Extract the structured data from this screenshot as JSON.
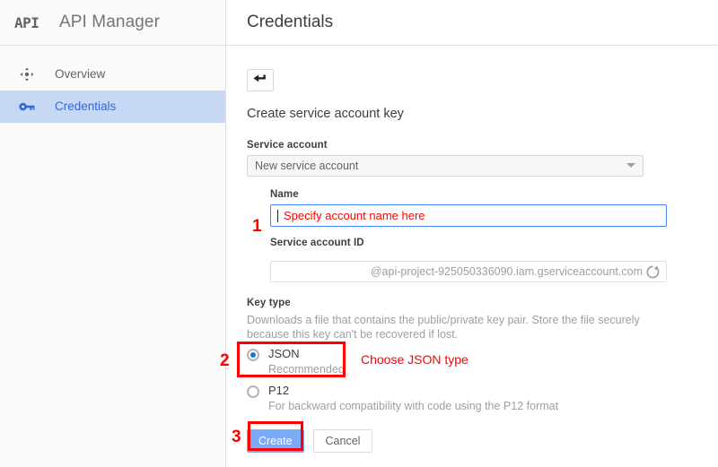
{
  "sidebar": {
    "logo_text": "API",
    "brand_title": "API Manager",
    "items": [
      {
        "label": "Overview",
        "icon": "move-arrows-icon",
        "active": false
      },
      {
        "label": "Credentials",
        "icon": "key-icon",
        "active": true
      }
    ]
  },
  "main": {
    "page_title": "Credentials",
    "back_button_icon": "back-arrow-icon",
    "section_title": "Create service account key",
    "form": {
      "service_account": {
        "label": "Service account",
        "selected_value": "New service account",
        "caret_icon": "chevron-down-icon"
      },
      "name": {
        "label": "Name",
        "value": "Specify account name here"
      },
      "service_account_id": {
        "label": "Service account ID",
        "value": "@api-project-925050336090.iam.gserviceaccount.com",
        "refresh_icon": "refresh-icon"
      },
      "key_type": {
        "label": "Key type",
        "description": "Downloads a file that contains the public/private key pair. Store the file securely because this key can't be recovered if lost.",
        "options": [
          {
            "label": "JSON",
            "sublabel": "Recommended",
            "selected": true
          },
          {
            "label": "P12",
            "sublabel": "For backward compatibility with code using the P12 format",
            "selected": false
          }
        ]
      }
    },
    "buttons": {
      "create": "Create",
      "cancel": "Cancel"
    }
  },
  "annotations": {
    "step1_number": "1",
    "step2_number": "2",
    "step3_number": "3",
    "choose_json_text": "Choose JSON type",
    "color": "#ff0000"
  }
}
